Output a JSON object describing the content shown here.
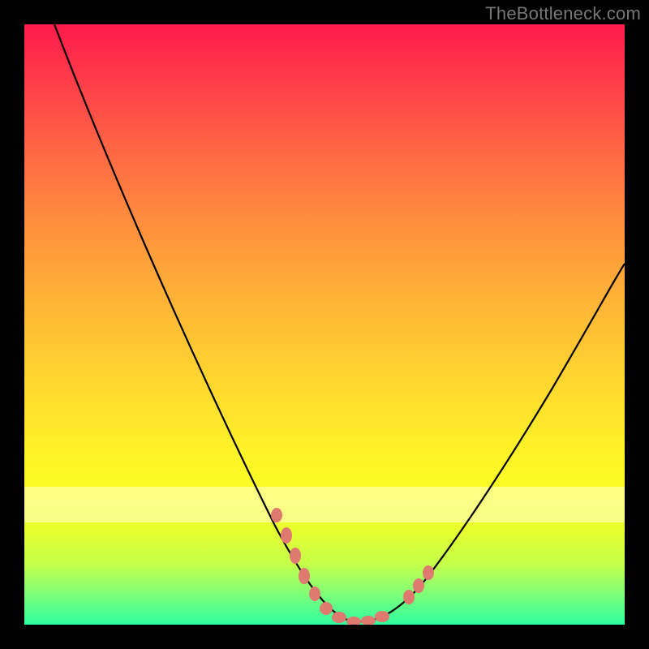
{
  "watermark": "TheBottleneck.com",
  "gradient": {
    "top": "#ff1a4b",
    "mid": "#ffe52a",
    "bottom": "#2effa0"
  },
  "curve_color": "#000000",
  "marker_color": "#e0786d",
  "chart_data": {
    "type": "line",
    "title": "",
    "xlabel": "",
    "ylabel": "",
    "xlim": [
      0,
      100
    ],
    "ylim": [
      0,
      100
    ],
    "grid": false,
    "series": [
      {
        "name": "bottleneck-curve",
        "x": [
          5,
          10,
          15,
          20,
          25,
          30,
          35,
          40,
          43,
          46,
          49,
          52,
          55,
          58,
          62,
          66,
          70,
          75,
          80,
          85,
          90,
          95,
          100
        ],
        "y": [
          100,
          90,
          79,
          67,
          56,
          45,
          34,
          23,
          16,
          10,
          5,
          2,
          0.5,
          0.5,
          2,
          6,
          12,
          20,
          29,
          37,
          45,
          53,
          60
        ]
      }
    ],
    "markers": {
      "name": "highlighted-points",
      "x": [
        42,
        44,
        46,
        47.5,
        49,
        51,
        53,
        55,
        57,
        59,
        63.5,
        65,
        66.5
      ],
      "y": [
        18,
        14,
        10,
        7,
        5,
        2.5,
        1,
        0.5,
        0.5,
        1,
        4,
        6,
        8
      ]
    },
    "bands": [
      {
        "y_from": 18,
        "y_to": 23,
        "alpha": 0.55
      }
    ]
  }
}
